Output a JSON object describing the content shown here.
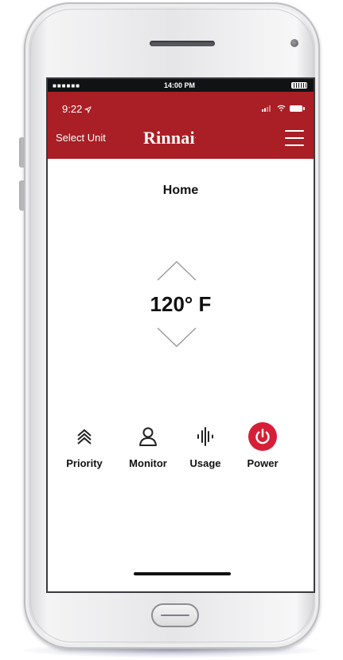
{
  "device": {
    "simulator_time": "14:00 PM",
    "simulator_carrier_dots": "■■■■■■"
  },
  "status_bar": {
    "time": "9:22"
  },
  "header": {
    "left_button_label": "Select Unit",
    "brand": "Rinnai",
    "brand_mark": ".",
    "accent_color": "#a91f25"
  },
  "page": {
    "title": "Home"
  },
  "temperature": {
    "display": "120° F"
  },
  "actions": [
    {
      "label": "Priority",
      "icon": "double-chevron-up-icon"
    },
    {
      "label": "Monitor",
      "icon": "person-icon"
    },
    {
      "label": "Usage",
      "icon": "waveform-icon"
    },
    {
      "label": "Power",
      "icon": "power-icon",
      "color": "#d51f36"
    }
  ]
}
